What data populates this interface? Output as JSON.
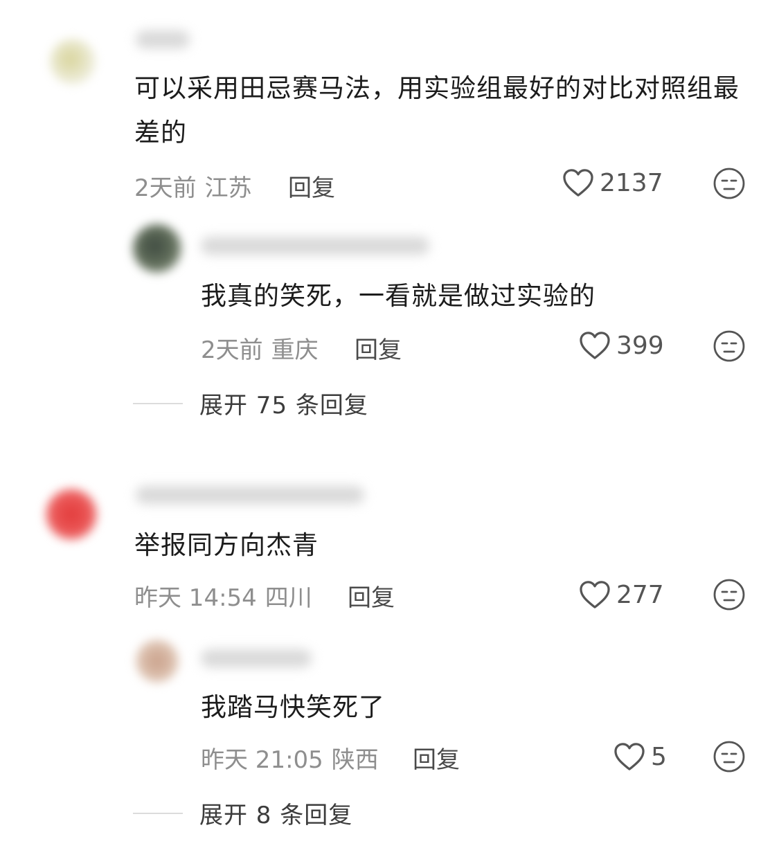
{
  "comments": [
    {
      "text": "可以采用田忌赛马法，用实验组最好的对比对照组最差的",
      "time": "2天前",
      "location": "江苏",
      "reply_label": "回复",
      "likes": "2137",
      "replies": [
        {
          "text": "我真的笑死，一看就是做过实验的",
          "time": "2天前",
          "location": "重庆",
          "reply_label": "回复",
          "likes": "399"
        }
      ],
      "expand_label": "展开 75 条回复"
    },
    {
      "text": "举报同方向杰青",
      "time": "昨天 14:54",
      "location": "四川",
      "reply_label": "回复",
      "likes": "277",
      "replies": [
        {
          "text": "我踏马快笑死了",
          "time": "昨天 21:05",
          "location": "陕西",
          "reply_label": "回复",
          "likes": "5"
        }
      ],
      "expand_label": "展开 8 条回复"
    }
  ],
  "icons": {
    "like": "heart-outline-icon",
    "emoji": "neutral-face-icon"
  },
  "colors": {
    "text": "#1c1c1c",
    "meta": "#8e8e8e",
    "icon": "#555555"
  }
}
